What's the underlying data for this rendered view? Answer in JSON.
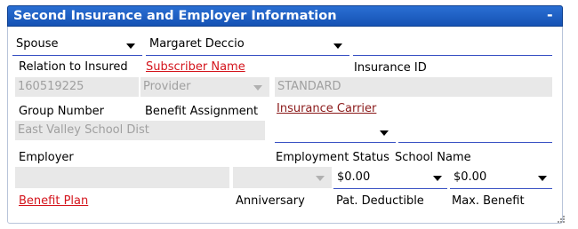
{
  "panel": {
    "title": "Second Insurance and Employer Information",
    "collapse_symbol": "-"
  },
  "row1": {
    "relation_value": "Spouse",
    "subscriber_value": "Margaret Deccio",
    "insurance_id_value": ""
  },
  "row1_labels": {
    "relation": "Relation to Insured",
    "subscriber": "Subscriber Name",
    "insurance_id": "Insurance ID"
  },
  "row2": {
    "group_number": "160519225",
    "benefit_assignment": "Provider",
    "carrier_standard": "STANDARD"
  },
  "row2_labels": {
    "group_number": "Group Number",
    "benefit_assignment": "Benefit Assignment",
    "insurance_carrier": "Insurance Carrier"
  },
  "row3": {
    "employer_name": "East Valley School Dist",
    "carrier_select": "",
    "carrier_extra": ""
  },
  "row3_labels": {
    "employer": "Employer",
    "employment_status": "Employment Status",
    "school_name": "School Name"
  },
  "row4": {
    "benefit_plan_value": "",
    "anniversary_value": "",
    "pat_deductible": "$0.00",
    "max_benefit": "$0.00"
  },
  "row4_labels": {
    "benefit_plan": "Benefit Plan",
    "anniversary": "Anniversary",
    "pat_deductible": "Pat. Deductible",
    "max_benefit": "Max. Benefit"
  },
  "colors": {
    "title_bar": "#1a5cc2",
    "link_red": "#d4141c",
    "link_dark_red": "#8b1a1a",
    "field_underline": "#3a52c4",
    "disabled_bg": "#e8e8e8"
  }
}
